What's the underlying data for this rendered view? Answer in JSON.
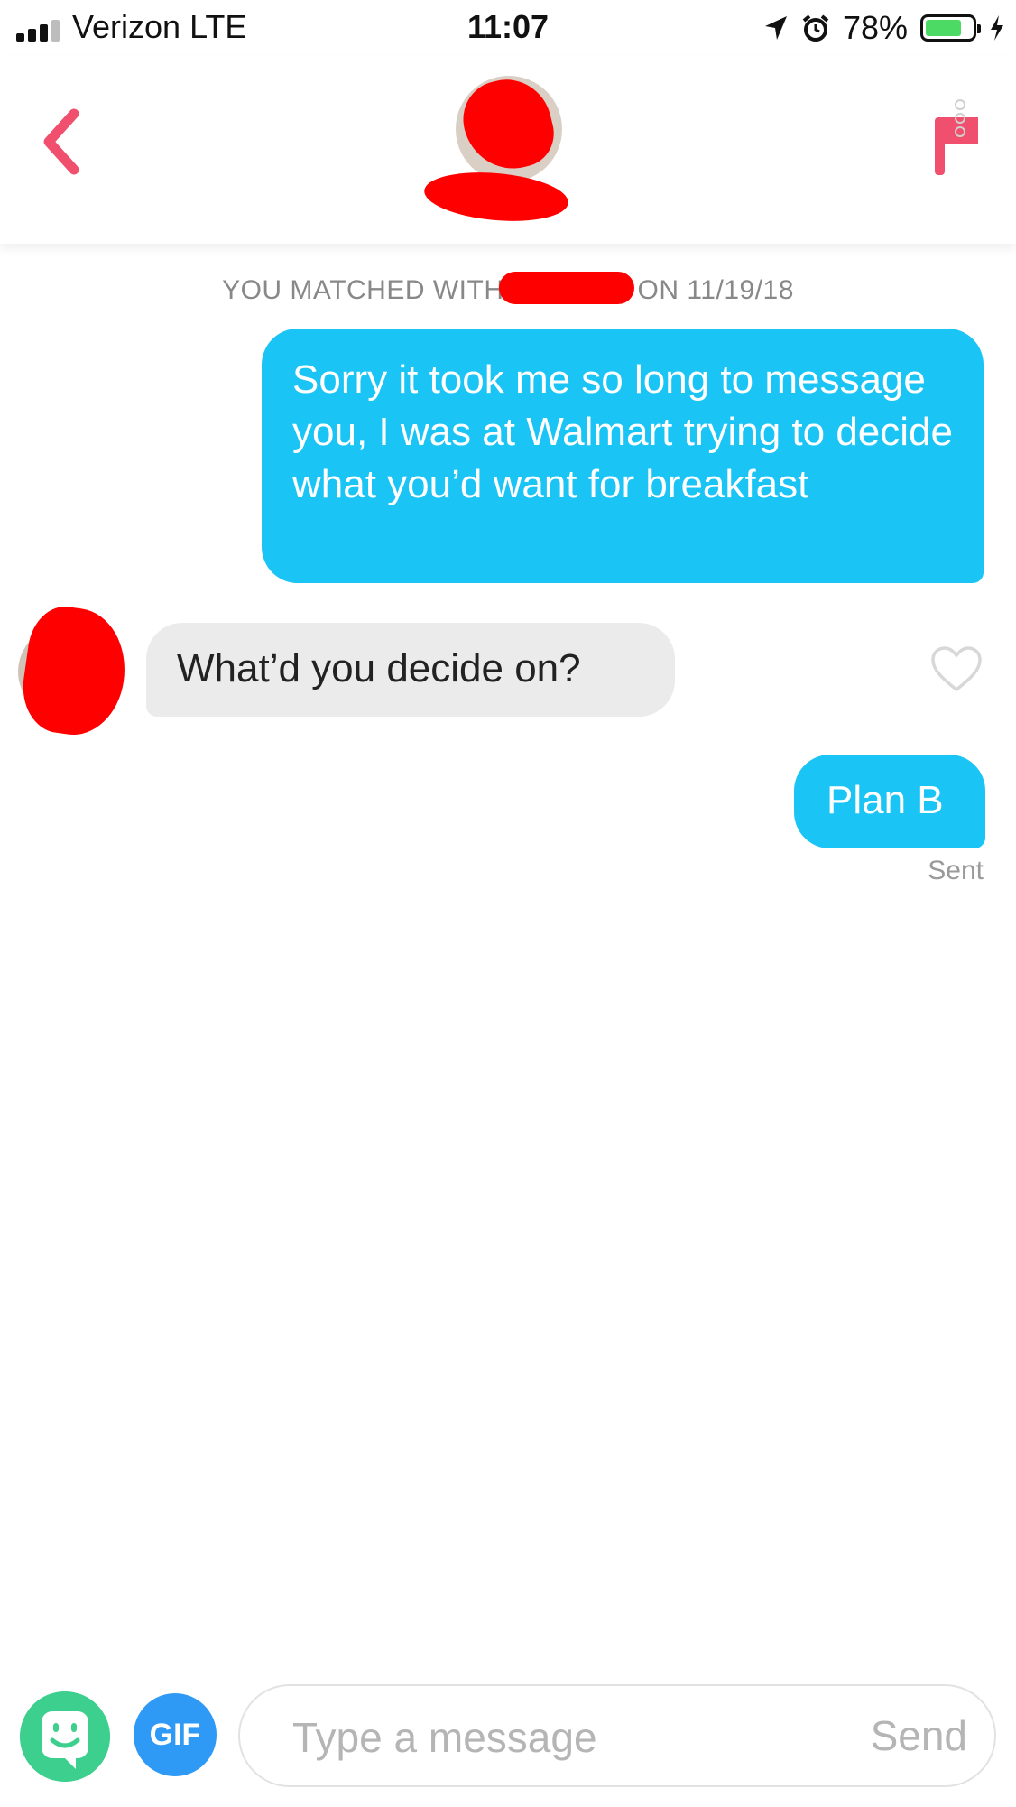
{
  "status_bar": {
    "carrier": "Verizon  LTE",
    "time": "11:07",
    "battery_percent": "78%"
  },
  "header": {
    "back_icon": "chevron-left-icon",
    "report_icon": "flag-icon",
    "accent_color": "#f0506e"
  },
  "chat": {
    "match_prefix": "YOU MATCHED WITH",
    "match_suffix": "ON 11/19/18",
    "messages": [
      {
        "direction": "sent",
        "text": "Sorry it took me so long to message you, I was at Walmart trying to decide what you’d want for breakfast"
      },
      {
        "direction": "received",
        "text": "What’d you decide on?"
      },
      {
        "direction": "sent",
        "text": "Plan B"
      }
    ],
    "sent_status": "Sent",
    "sent_bubble_color": "#1ac4f5",
    "received_bubble_color": "#ebebeb"
  },
  "composer": {
    "gif_label": "GIF",
    "placeholder": "Type a message",
    "send_label": "Send",
    "sticker_icon": "sticker-face-icon"
  }
}
